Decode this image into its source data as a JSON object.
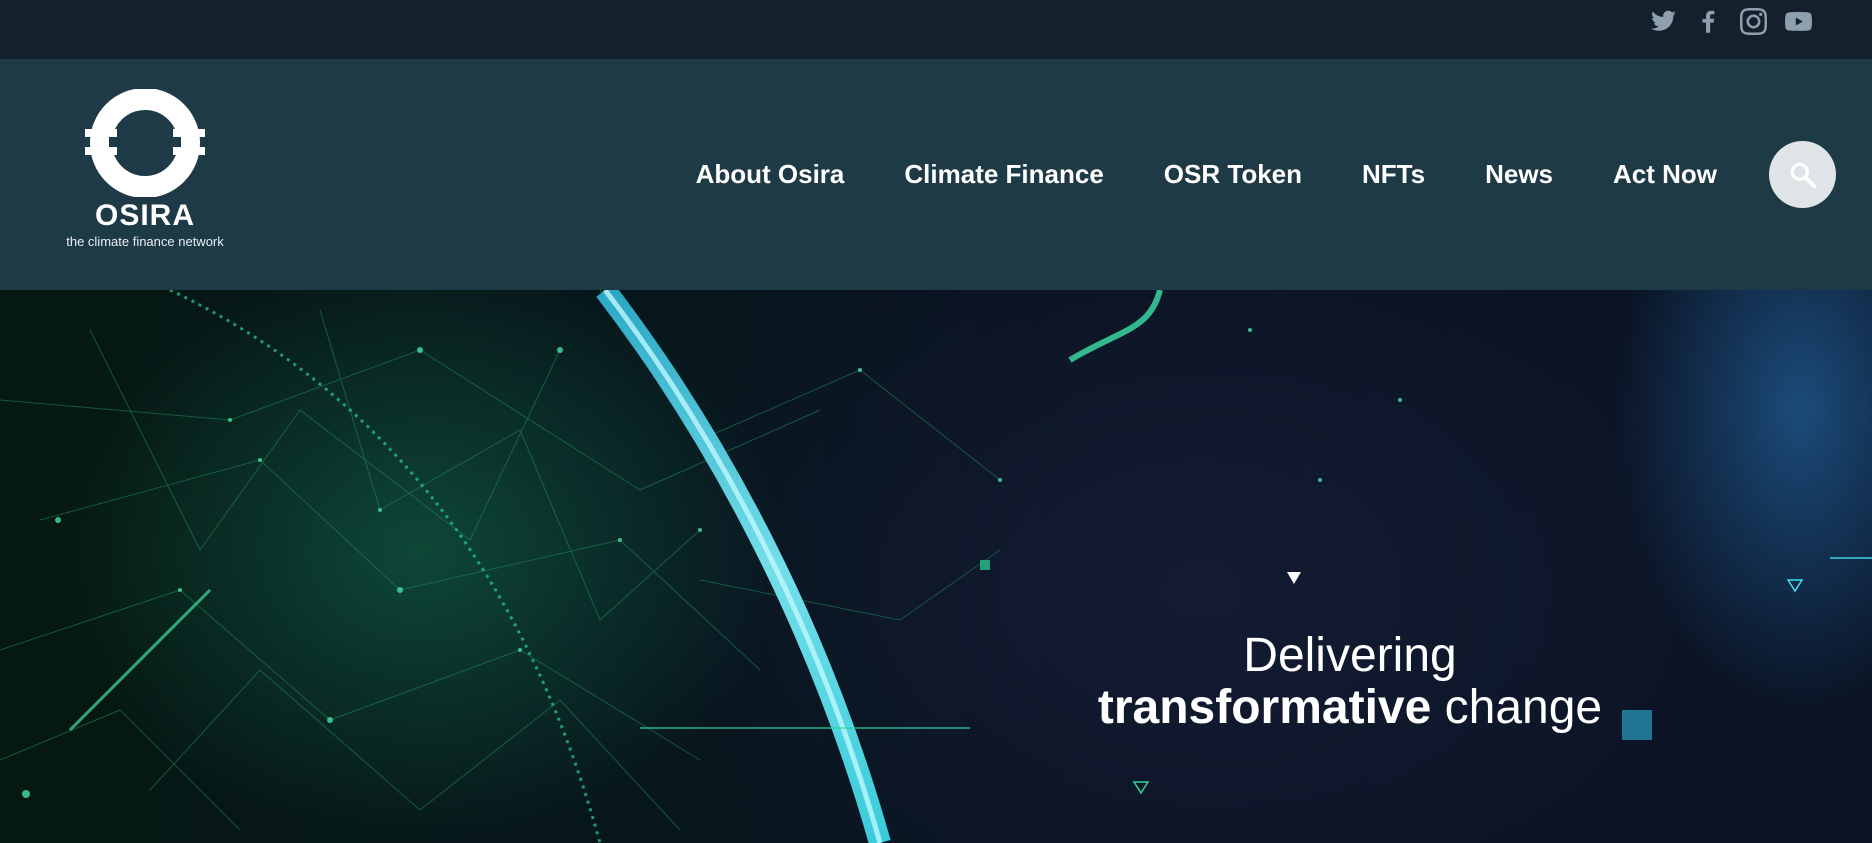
{
  "social": {
    "icons": [
      "twitter-icon",
      "facebook-icon",
      "instagram-icon",
      "youtube-icon"
    ]
  },
  "logo": {
    "brand": "OSIRA",
    "tagline": "the climate finance network"
  },
  "nav": {
    "items": [
      "About Osira",
      "Climate Finance",
      "OSR Token",
      "NFTs",
      "News",
      "Act Now"
    ]
  },
  "search": {
    "icon": "search-icon"
  },
  "hero": {
    "line1": "Delivering",
    "line2_strong": "transformative",
    "line2_rest": " change"
  },
  "colors": {
    "topbar": "#14212d",
    "header": "#1e3a47",
    "accent_cyan": "#3fe0f0",
    "accent_green": "#2fd59a"
  }
}
